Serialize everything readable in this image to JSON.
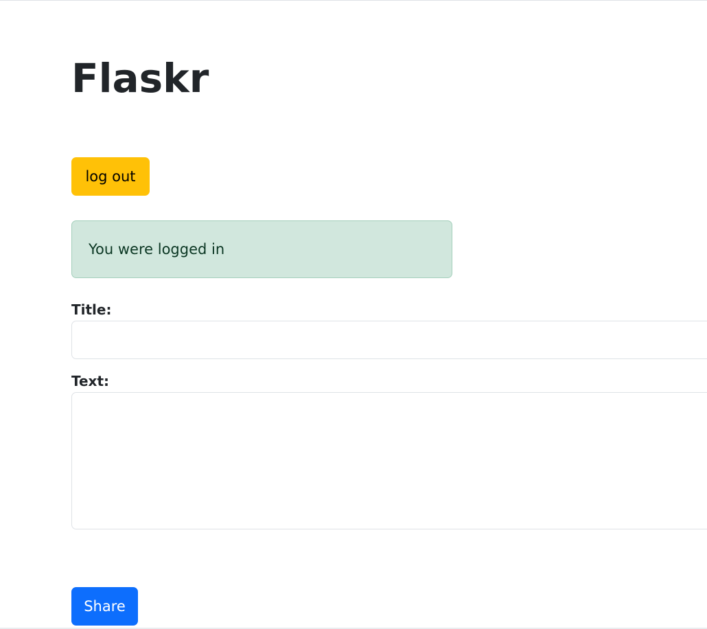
{
  "header": {
    "title": "Flaskr"
  },
  "auth": {
    "logout_label": "log out"
  },
  "flash": {
    "message": "You were logged in"
  },
  "form": {
    "title_label": "Title:",
    "title_value": "",
    "text_label": "Text:",
    "text_value": "",
    "submit_label": "Share"
  },
  "colors": {
    "logout_button": "#ffc107",
    "share_button": "#0d6efd",
    "alert_background": "#d1e7dd"
  }
}
